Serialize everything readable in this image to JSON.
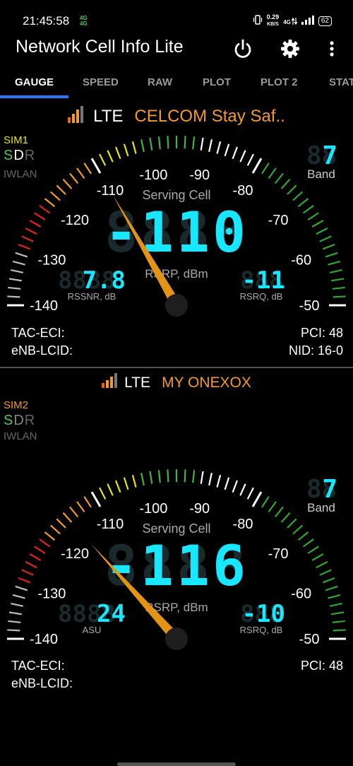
{
  "status_bar": {
    "time": "21:45:58",
    "net_type_a": "4G",
    "net_type_b": "4G",
    "speed_value": "0.29",
    "speed_unit": "KB/S",
    "signal_label": "4G",
    "battery": "62"
  },
  "app_bar": {
    "title": "Network Cell Info Lite",
    "power_icon": "power-icon",
    "settings_icon": "gear-icon",
    "more_icon": "more-vertical-icon"
  },
  "tabs": [
    {
      "label": "GAUGE",
      "active": true
    },
    {
      "label": "SPEED",
      "active": false
    },
    {
      "label": "RAW",
      "active": false
    },
    {
      "label": "PLOT",
      "active": false
    },
    {
      "label": "PLOT 2",
      "active": false
    },
    {
      "label": "STAT",
      "active": false
    }
  ],
  "colors": {
    "accent": "#2979ff",
    "operator": "#f39a2a",
    "lcd": "#19e6ff",
    "needle": "#e39414",
    "sdr_s": "#5cc35c"
  },
  "gauge_scale": {
    "labels": [
      "-140",
      "-130",
      "-120",
      "-110",
      "-100",
      "-90",
      "-80",
      "-70",
      "-60",
      "-50"
    ],
    "center_label": "Serving Cell",
    "center_unit": "RSRP, dBm"
  },
  "sim1": {
    "tech": "LTE",
    "operator": "CELCOM Stay Saf..",
    "sim_label": "SIM1",
    "sdr_s": "S",
    "sdr_d": "D",
    "sdr_r": "R",
    "iwlan": "IWLAN",
    "band_value": "7",
    "band_label": "Band",
    "rsrp_value": "-110",
    "rsrp_level": -110,
    "left_value": "7.8",
    "left_label": "RSSNR, dB",
    "right_value": "-11",
    "right_label": "RSRQ, dB",
    "tac_eci": "TAC-ECI:",
    "enb_lcid": "eNB-LCID:",
    "pci": "PCI: 48",
    "nid": "NID: 16-0"
  },
  "sim2": {
    "tech": "LTE",
    "operator": "MY ONEXOX",
    "sim_label": "SIM2",
    "sdr_s": "S",
    "sdr_d": "D",
    "sdr_r": "R",
    "iwlan": "IWLAN",
    "band_value": "7",
    "band_label": "Band",
    "rsrp_value": "-116",
    "rsrp_level": -116,
    "left_value": "24",
    "left_label": "ASU",
    "right_value": "-10",
    "right_label": "RSRQ, dB",
    "tac_eci": "TAC-ECI:",
    "enb_lcid": "eNB-LCID:",
    "pci": "PCI: 48"
  }
}
